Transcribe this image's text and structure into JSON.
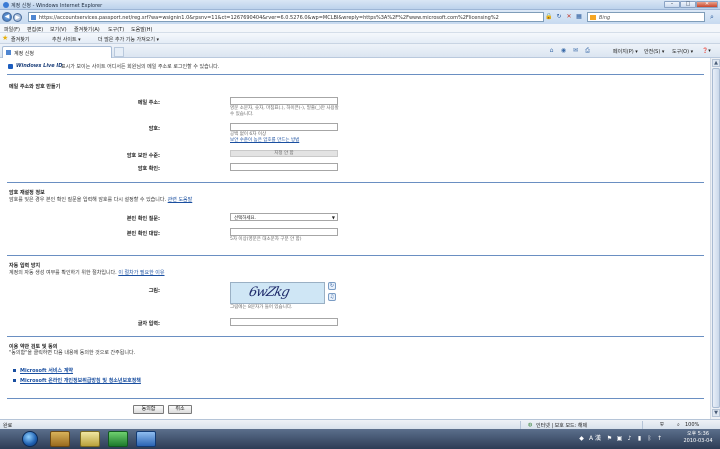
{
  "window": {
    "title": "계정 신청 - Windows Internet Explorer",
    "min_label": "–",
    "max_label": "□",
    "close_label": "✕"
  },
  "address": {
    "url": "https://accountservices.passport.net/reg.srf?wa=wsignin1.0&rpsnv=11&ct=1267690404&rver=6.0.5276.0&wp=MCLBI&wreply=https%3A%2F%2Fwww.microsoft.com%2Flicensing%2Fservicecenter%2Fhome.aspx",
    "search_engine": "Bing"
  },
  "menu": [
    "파일(F)",
    "편집(E)",
    "보기(V)",
    "즐겨찾기(A)",
    "도구(T)",
    "도움말(H)"
  ],
  "favorites": {
    "label": "즐겨찾기",
    "suggested": "추천 사이트 ▾",
    "addons": "더 많은 추가 기능 가져오기 ▾"
  },
  "tab": {
    "label": "계정 신청"
  },
  "commands": {
    "page": "페이지(P) ▾",
    "safety": "안전(S) ▾",
    "tools": "도구(O) ▾",
    "help": "❓▾"
  },
  "page": {
    "brand": "Windows Live ID",
    "intro": "표시가 보이는 사이트 어디서든 회원님의 메일 주소로 로그인할 수 있습니다.",
    "section1": {
      "title": "메일 주소와 암호 만들기",
      "email_label": "메일 주소:",
      "email_hint": "영문 소문자, 숫자, 마침표(.), 하이픈(-), 밑줄(_)만 사용할 수 있습니다.",
      "password_label": "암호:",
      "password_hint": "공백 없이 6자 이상",
      "password_link": "보안 수준이 높은 암호를 만드는 방법",
      "strength_label": "암호 보안 수준:",
      "strength_value": "지정 안 함",
      "confirm_label": "암호 확인:"
    },
    "section2": {
      "title": "암호 재설정 정보",
      "desc": "암호를 잊은 경우 본인 확인 질문을 입력해 암호를 다시 설정할 수 있습니다.",
      "desc_link": "관련 도움말",
      "question_label": "본인 확인 질문:",
      "question_value": "선택하세요.",
      "answer_label": "본인 확인 대답:",
      "answer_hint": "5자 이상(영문은 대소문자 구분 안 함)"
    },
    "section3": {
      "title": "자동 입력 방지",
      "desc": "계정의 자동 생성 여부를 확인하기 위한 절차입니다.",
      "desc_link": "이 절차가 필요한 이유",
      "image_label": "그림:",
      "captcha_text": "6wZkg",
      "captcha_hint": "그림에는 8문자가 들어 있습니다.",
      "chars_label": "글자 입력:"
    },
    "section4": {
      "title": "이용 약관 검토 및 동의",
      "desc": "\"동의함\"을 클릭하면 다음 내용에 동의한 것으로 간주됩니다.",
      "links": [
        "Microsoft 서비스 계약",
        "Microsoft 온라인 개인정보취급방침 및 청소년보호정책"
      ]
    },
    "buttons": {
      "agree": "동의함",
      "cancel": "취소"
    }
  },
  "status": {
    "left": "완료",
    "zone": "인터넷 | 보호 모드: 해제",
    "zoom": "100%"
  },
  "taskbar": {
    "time": "오후 5:36",
    "date": "2010-03-04",
    "lang": "A 漢"
  }
}
